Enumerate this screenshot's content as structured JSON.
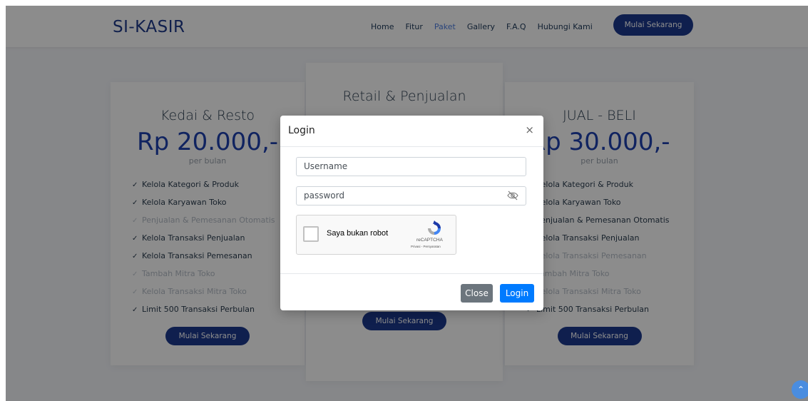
{
  "navbar": {
    "brand": "SI-KASIR",
    "links": [
      "Home",
      "Fitur",
      "Paket",
      "Gallery",
      "F.A.Q",
      "Hubungi Kami"
    ],
    "active_link": "Paket",
    "cta": "Mulai Sekarang"
  },
  "pricing": [
    {
      "title": "Kedai & Resto",
      "price": "Rp 20.000,-",
      "period": "per bulan",
      "features": [
        {
          "label": "Kelola Kategori & Produk",
          "enabled": true
        },
        {
          "label": "Kelola Karyawan Toko",
          "enabled": true
        },
        {
          "label": "Penjualan & Pemesanan Otomatis",
          "enabled": false
        },
        {
          "label": "Kelola Transaksi Penjualan",
          "enabled": true
        },
        {
          "label": "Kelola Transaksi Pemesanan",
          "enabled": true
        },
        {
          "label": "Tambah Mitra Toko",
          "enabled": false
        },
        {
          "label": "Kelola Transaksi Mitra Toko",
          "enabled": false
        },
        {
          "label": "Limit 500 Transaksi Perbulan",
          "enabled": true
        }
      ],
      "button": "Mulai Sekarang"
    },
    {
      "title": "Retail & Penjualan",
      "button": "Mulai Sekarang"
    },
    {
      "title": "JUAL - BELI",
      "price": "Rp 30.000,-",
      "period": "per bulan",
      "features": [
        {
          "label": "Kelola Kategori & Produk",
          "enabled": true
        },
        {
          "label": "Kelola Karyawan Toko",
          "enabled": true
        },
        {
          "label": "Penjualan & Pemesanan Otomatis",
          "enabled": true
        },
        {
          "label": "Kelola Transaksi Penjualan",
          "enabled": true
        },
        {
          "label": "Kelola Transaksi Pemesanan",
          "enabled": false
        },
        {
          "label": "Tambah Mitra Toko",
          "enabled": false
        },
        {
          "label": "Kelola Transaksi Mitra Toko",
          "enabled": false
        },
        {
          "label": "Limit 500 Transaksi Perbulan",
          "enabled": true
        }
      ],
      "button": "Mulai Sekarang"
    }
  ],
  "modal": {
    "title": "Login",
    "close_glyph": "×",
    "username_placeholder": "Username",
    "password_placeholder": "password",
    "captcha_label": "Saya bukan robot",
    "captcha_brand": "reCAPTCHA",
    "captcha_links": "Privasi - Persyaratan",
    "close_button": "Close",
    "login_button": "Login"
  },
  "check_glyph": "✓",
  "scroll_top_glyph": "⌃",
  "colors": {
    "brand_navy": "#1d3a8f",
    "primary_blue": "#007bff",
    "secondary_gray": "#6c757d",
    "active_link": "#4f7fe0"
  }
}
